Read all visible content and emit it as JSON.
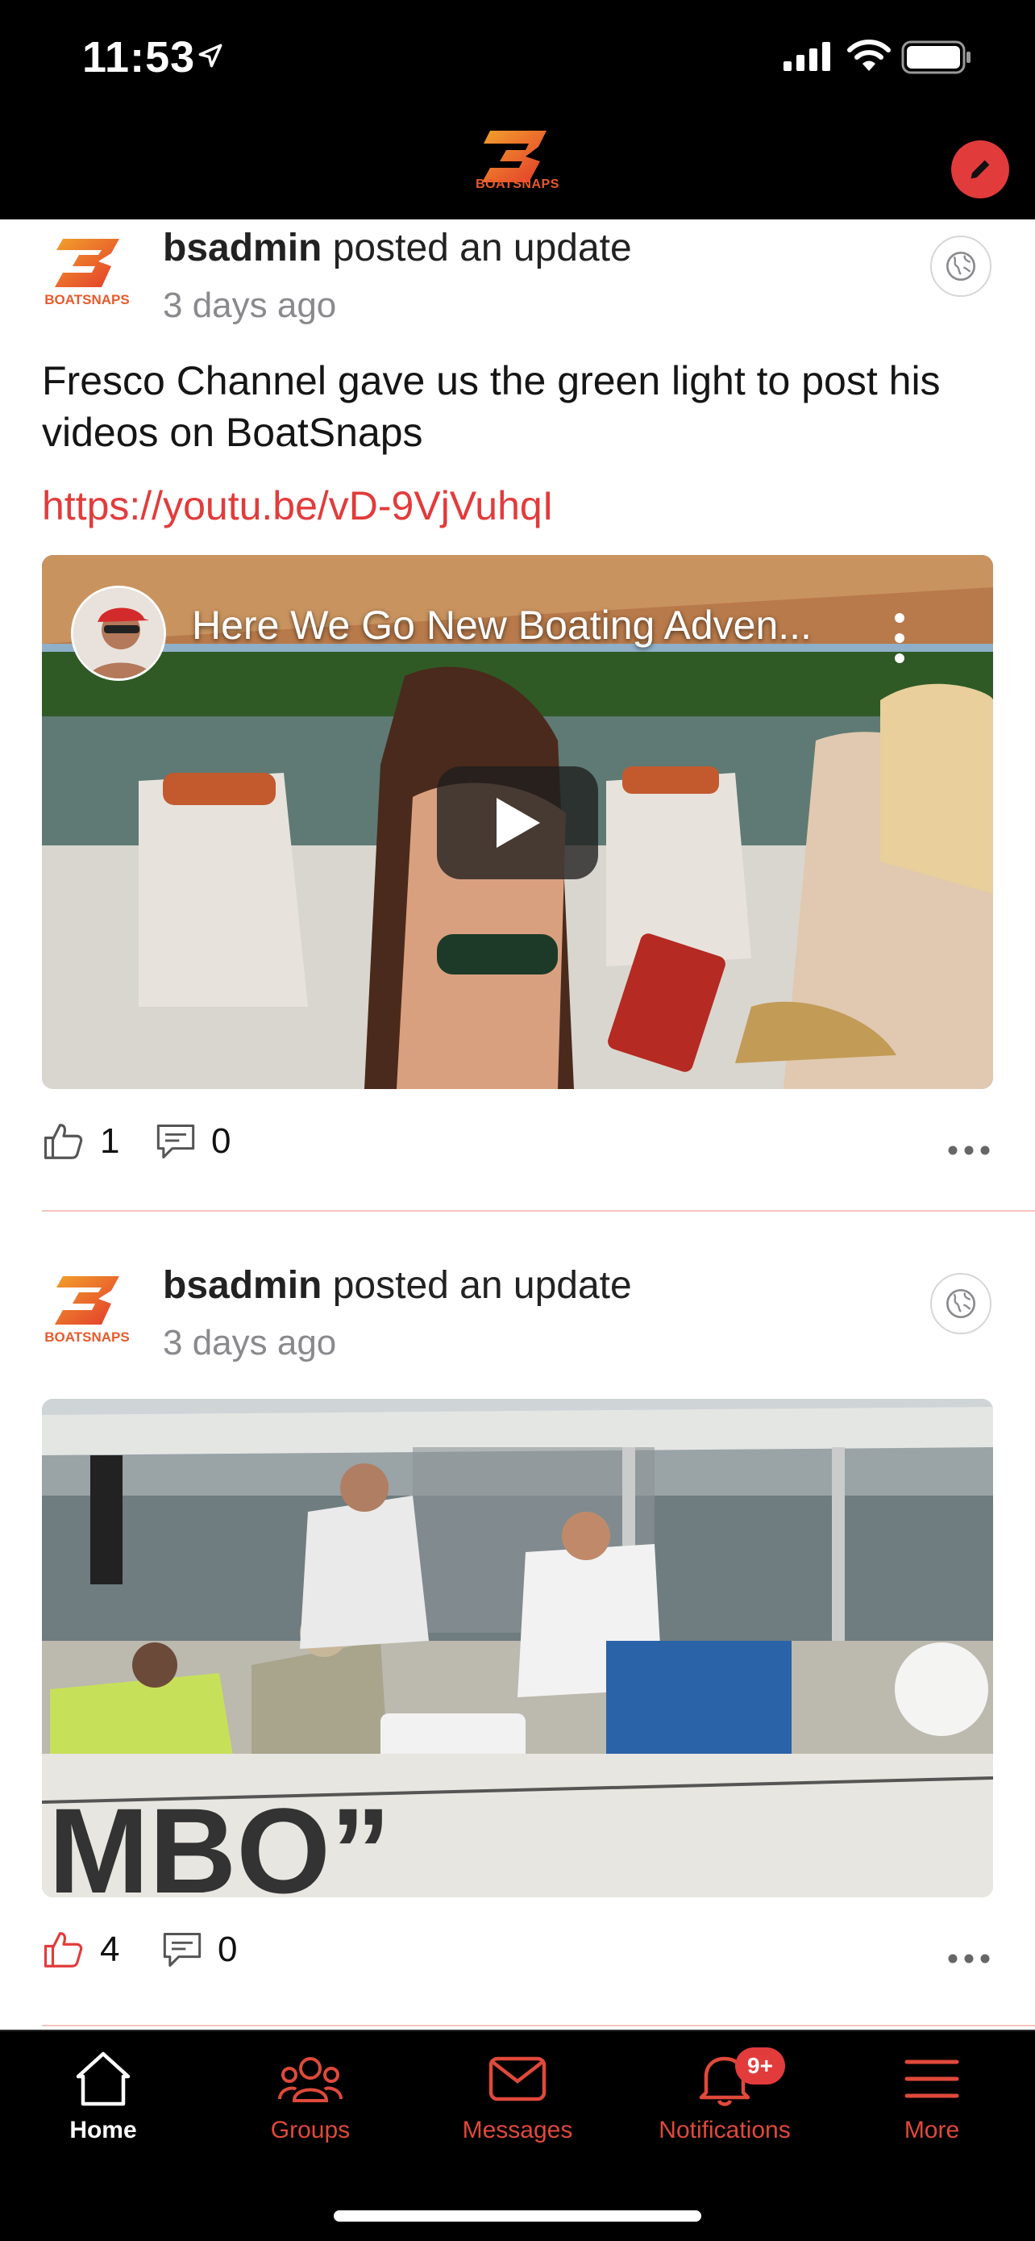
{
  "status_bar": {
    "time": "11:53"
  },
  "header": {
    "logo_text": "BOATSNAPS"
  },
  "posts": [
    {
      "author": "bsadmin",
      "action": "posted an update",
      "time": "3 days ago",
      "avatar_text": "BOATSNAPS",
      "text": "Fresco Channel gave us the green light to post his videos on BoatSnaps",
      "link": "https://youtu.be/vD-9VjVuhqI",
      "video_title": "Here We Go New Boating Adven...",
      "likes": "1",
      "comments": "0"
    },
    {
      "author": "bsadmin",
      "action": "posted an update",
      "time": "3 days ago",
      "avatar_text": "BOATSNAPS",
      "likes": "4",
      "comments": "0"
    }
  ],
  "tabs": [
    {
      "label": "Home",
      "icon": "home-icon",
      "active": true
    },
    {
      "label": "Groups",
      "icon": "groups-icon"
    },
    {
      "label": "Messages",
      "icon": "messages-icon"
    },
    {
      "label": "Notifications",
      "icon": "bell-icon",
      "badge": "9+"
    },
    {
      "label": "More",
      "icon": "menu-icon"
    }
  ],
  "colors": {
    "accent": "#e23b3b",
    "brand_orange": "#e85a2a",
    "link": "#e23b3b",
    "bar_bg": "#000000"
  }
}
